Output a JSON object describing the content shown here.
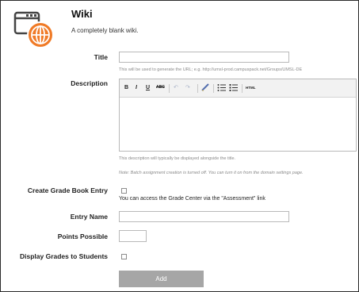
{
  "header": {
    "title": "Wiki",
    "subtitle": "A completely blank wiki.",
    "icon": "wiki-globe-icon"
  },
  "form": {
    "title_label": "Title",
    "title_value": "",
    "title_hint": "This will be used to generate the URL; e.g. http://umsl-prod.campuspack.net/Groups/UMSL-DE",
    "description_label": "Description",
    "description_hint": "This description will typically be displayed alongside the title.",
    "batch_note": "Note: Batch assignment creation is turned off. You can turn it on from the domain settings page.",
    "grade_book_label": "Create Grade Book Entry",
    "grade_book_note": "You can access the Grade Center via the \"Assessment\" link",
    "entry_name_label": "Entry Name",
    "entry_name_value": "",
    "points_label": "Points Possible",
    "points_value": "",
    "display_grades_label": "Display Grades to Students",
    "add_button": "Add"
  },
  "editor_toolbar": {
    "bold": "B",
    "italic": "I",
    "underline": "U",
    "strike": "ABC",
    "html": "HTML"
  }
}
